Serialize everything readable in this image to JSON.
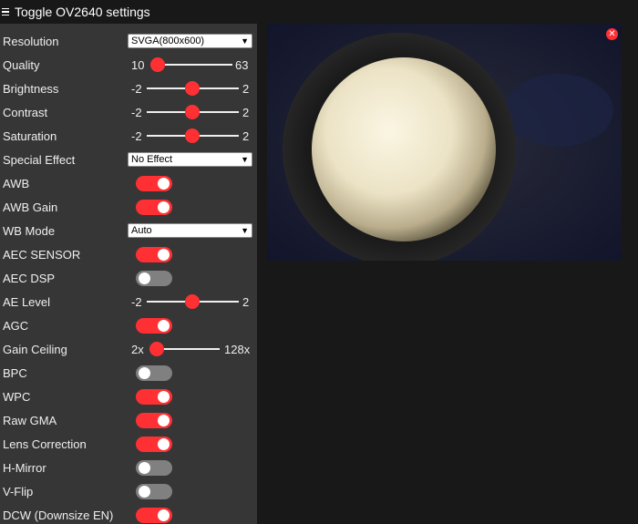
{
  "header": {
    "title": "Toggle OV2640 settings",
    "menu_icon": "hamburger-icon"
  },
  "colors": {
    "accent": "#ff3034",
    "sidebar_bg": "#363636",
    "page_bg": "#181818",
    "switch_off": "#808080"
  },
  "settings": {
    "resolution": {
      "label": "Resolution",
      "value": "SVGA(800x600)"
    },
    "quality": {
      "label": "Quality",
      "min": "10",
      "max": "63",
      "value": 10
    },
    "brightness": {
      "label": "Brightness",
      "min": "-2",
      "max": "2",
      "value": 0
    },
    "contrast": {
      "label": "Contrast",
      "min": "-2",
      "max": "2",
      "value": 0
    },
    "saturation": {
      "label": "Saturation",
      "min": "-2",
      "max": "2",
      "value": 0
    },
    "special_effect": {
      "label": "Special Effect",
      "value": "No Effect"
    },
    "awb": {
      "label": "AWB",
      "on": true
    },
    "awb_gain": {
      "label": "AWB Gain",
      "on": true
    },
    "wb_mode": {
      "label": "WB Mode",
      "value": "Auto"
    },
    "aec_sensor": {
      "label": "AEC SENSOR",
      "on": true
    },
    "aec_dsp": {
      "label": "AEC DSP",
      "on": false
    },
    "ae_level": {
      "label": "AE Level",
      "min": "-2",
      "max": "2",
      "value": 0
    },
    "agc": {
      "label": "AGC",
      "on": true
    },
    "gain_ceiling": {
      "label": "Gain Ceiling",
      "min": "2x",
      "max": "128x",
      "value": 0
    },
    "bpc": {
      "label": "BPC",
      "on": false
    },
    "wpc": {
      "label": "WPC",
      "on": true
    },
    "raw_gma": {
      "label": "Raw GMA",
      "on": true
    },
    "lens_correction": {
      "label": "Lens Correction",
      "on": true
    },
    "h_mirror": {
      "label": "H-Mirror",
      "on": false
    },
    "v_flip": {
      "label": "V-Flip",
      "on": false
    },
    "dcw": {
      "label": "DCW (Downsize EN)",
      "on": true
    }
  },
  "stream": {
    "close_icon": "close-icon",
    "close_glyph": "✕"
  }
}
